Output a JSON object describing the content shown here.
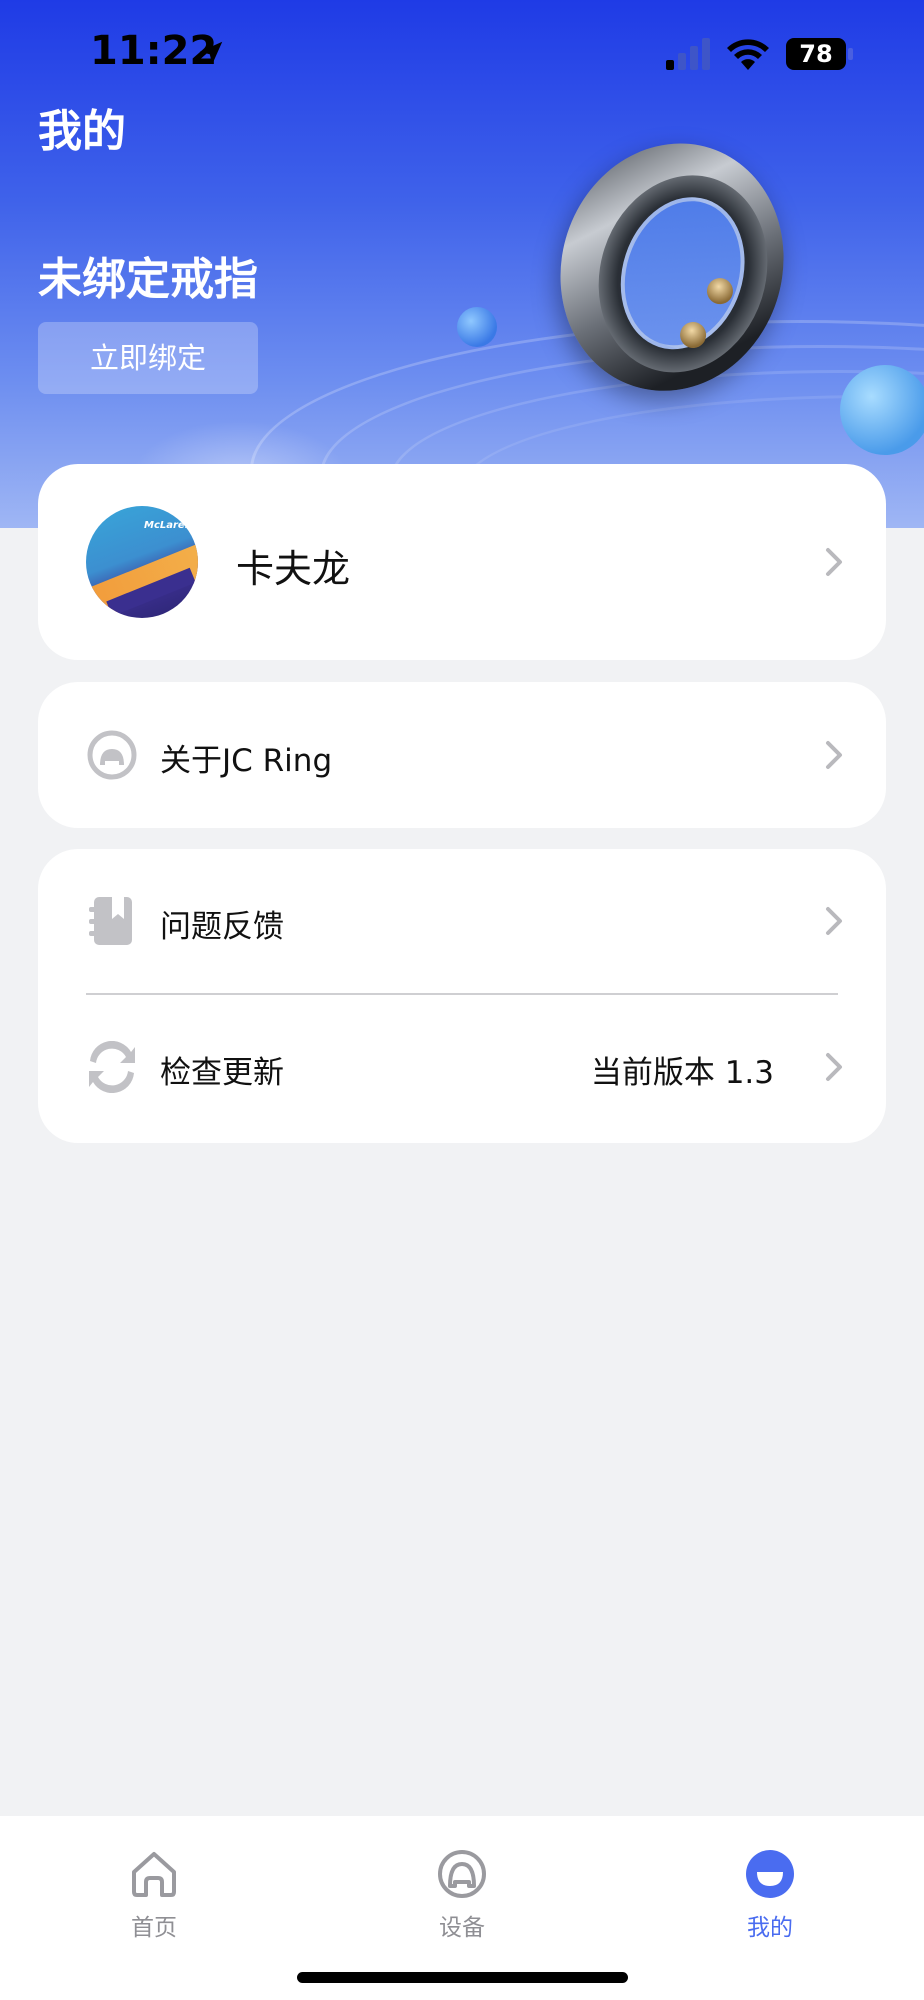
{
  "status_bar": {
    "time": "11:22",
    "battery": "78"
  },
  "header": {
    "page_title": "我的",
    "ring_status": "未绑定戒指",
    "bind_button": "立即绑定"
  },
  "profile": {
    "name": "卡夫龙",
    "avatar_text": "McLaren"
  },
  "menu": {
    "about_label": "关于JC Ring",
    "feedback_label": "问题反馈",
    "update_label": "检查更新",
    "update_value": "当前版本 1.3"
  },
  "tabs": [
    {
      "label": "首页"
    },
    {
      "label": "设备"
    },
    {
      "label": "我的"
    }
  ],
  "colors": {
    "accent": "#4a6cf0",
    "header_top": "#1f3be6",
    "background": "#f1f2f4",
    "inactive_tab": "#8f8f94"
  }
}
